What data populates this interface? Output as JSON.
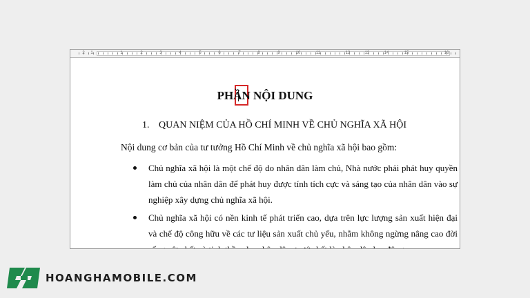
{
  "ruler": {
    "labels": [
      "2",
      "1",
      "1",
      "2",
      "3",
      "4",
      "5",
      "6",
      "7",
      "8",
      "9",
      "10",
      "11",
      "12",
      "13",
      "14",
      "15",
      "16"
    ]
  },
  "document": {
    "title": "PHẦN NỘI DUNG",
    "heading_number": "1.",
    "heading_text": "QUAN NIỆM CỦA HỒ CHÍ MINH VỀ CHỦ NGHĨA XÃ HỘI",
    "intro": "Nội dung cơ bản của tư tưởng Hồ Chí Minh về chủ nghĩa xã hội bao gồm:",
    "bullets": [
      "Chủ nghĩa xã hội là một chế độ do nhân dân làm chủ, Nhà nước phải phát huy quyền làm chủ của nhân dân để phát huy được tính tích cực và sáng tạo của nhân dân vào sự nghiệp xây dựng chủ nghĩa xã hội.",
      "Chủ nghĩa xã hội có nền kinh tế phát triển cao, dựa trên lực lượng sản xuất hiện đại và chế độ công hữu về các tư liệu sản xuất chủ yếu, nhằm không ngừng nâng cao đời sống vật chất và tinh thần cho nhân dân, trước hết là nhân dân lao động."
    ]
  },
  "brand": {
    "name": "HOANGHAMOBILE.COM",
    "logo_color": "#1f8a4c"
  },
  "highlight_color": "#d62828"
}
